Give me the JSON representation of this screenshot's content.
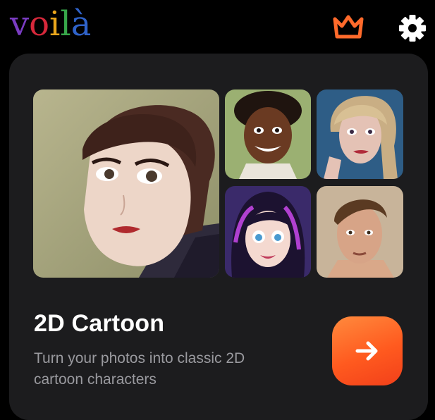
{
  "app": {
    "logo_letters": [
      {
        "char": "v",
        "color": "#7a3cc2"
      },
      {
        "char": "o",
        "color": "#d6283b"
      },
      {
        "char": "i",
        "color": "#e8a51c"
      },
      {
        "char": "l",
        "color": "#37a64a"
      },
      {
        "char": "à",
        "color": "#2f62c9"
      }
    ],
    "icons": {
      "premium": "crown-icon",
      "settings": "gear-icon"
    },
    "accent_color": "#ff5a1f"
  },
  "feature_card": {
    "title": "2D Cartoon",
    "description": "Turn your photos into classic 2D cartoon characters",
    "action_icon": "arrow-right-icon",
    "preview_images": [
      "cartoon-portrait-woman-short-dark-hair",
      "cartoon-portrait-smiling-boy-curly-hair",
      "cartoon-portrait-blonde-woman",
      "cartoon-portrait-girl-dark-hair-purple-streaks",
      "cartoon-portrait-man-brown-hair"
    ]
  }
}
